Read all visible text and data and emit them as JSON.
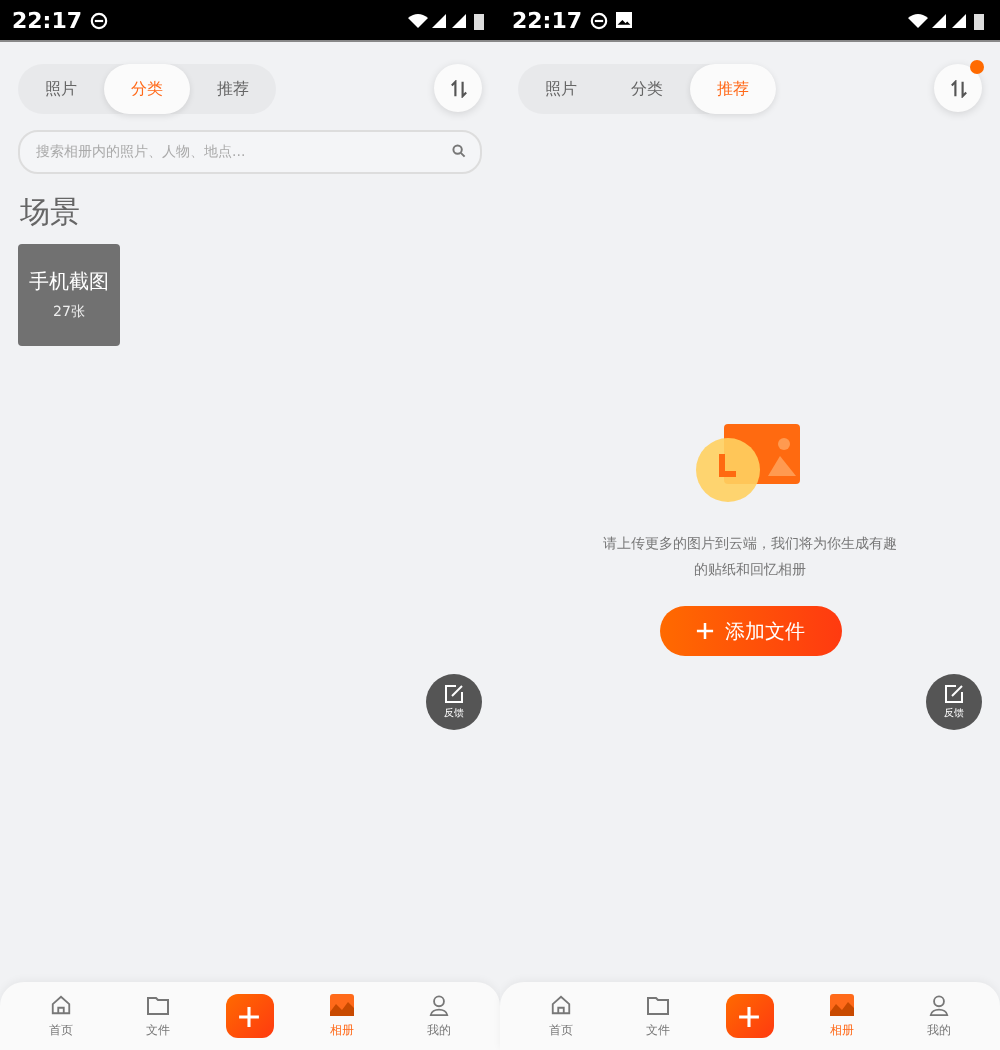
{
  "screens": [
    {
      "status_bar": {
        "time": "22:17",
        "notifications": [
          {
            "kind": "dnd"
          }
        ]
      },
      "tabs": [
        {
          "label": "照片",
          "selected": false
        },
        {
          "label": "分类",
          "selected": true
        },
        {
          "label": "推荐",
          "selected": false
        }
      ],
      "sort_button": {
        "badge": false
      },
      "search": {
        "placeholder": "搜索相册内的照片、人物、地点..."
      },
      "section": {
        "title": "场景",
        "cards": [
          {
            "title": "手机截图",
            "count": "27张"
          }
        ]
      },
      "feedback": {
        "label": "反馈"
      },
      "nav": [
        {
          "kind": "home",
          "label": "首页",
          "selected": false
        },
        {
          "kind": "folder",
          "label": "文件",
          "selected": false
        },
        {
          "kind": "add"
        },
        {
          "kind": "album",
          "label": "相册",
          "selected": true
        },
        {
          "kind": "user",
          "label": "我的",
          "selected": false
        }
      ]
    },
    {
      "status_bar": {
        "time": "22:17",
        "notifications": [
          {
            "kind": "dnd"
          },
          {
            "kind": "image"
          }
        ]
      },
      "tabs": [
        {
          "label": "照片",
          "selected": false
        },
        {
          "label": "分类",
          "selected": false
        },
        {
          "label": "推荐",
          "selected": true
        }
      ],
      "sort_button": {
        "badge": true
      },
      "empty": {
        "message": "请上传更多的图片到云端，我们将为你生成有趣的贴纸和回忆相册",
        "button": "添加文件"
      },
      "feedback": {
        "label": "反馈"
      },
      "nav": [
        {
          "kind": "home",
          "label": "首页",
          "selected": false
        },
        {
          "kind": "folder",
          "label": "文件",
          "selected": false
        },
        {
          "kind": "add"
        },
        {
          "kind": "album",
          "label": "相册",
          "selected": true
        },
        {
          "kind": "user",
          "label": "我的",
          "selected": false
        }
      ]
    }
  ]
}
